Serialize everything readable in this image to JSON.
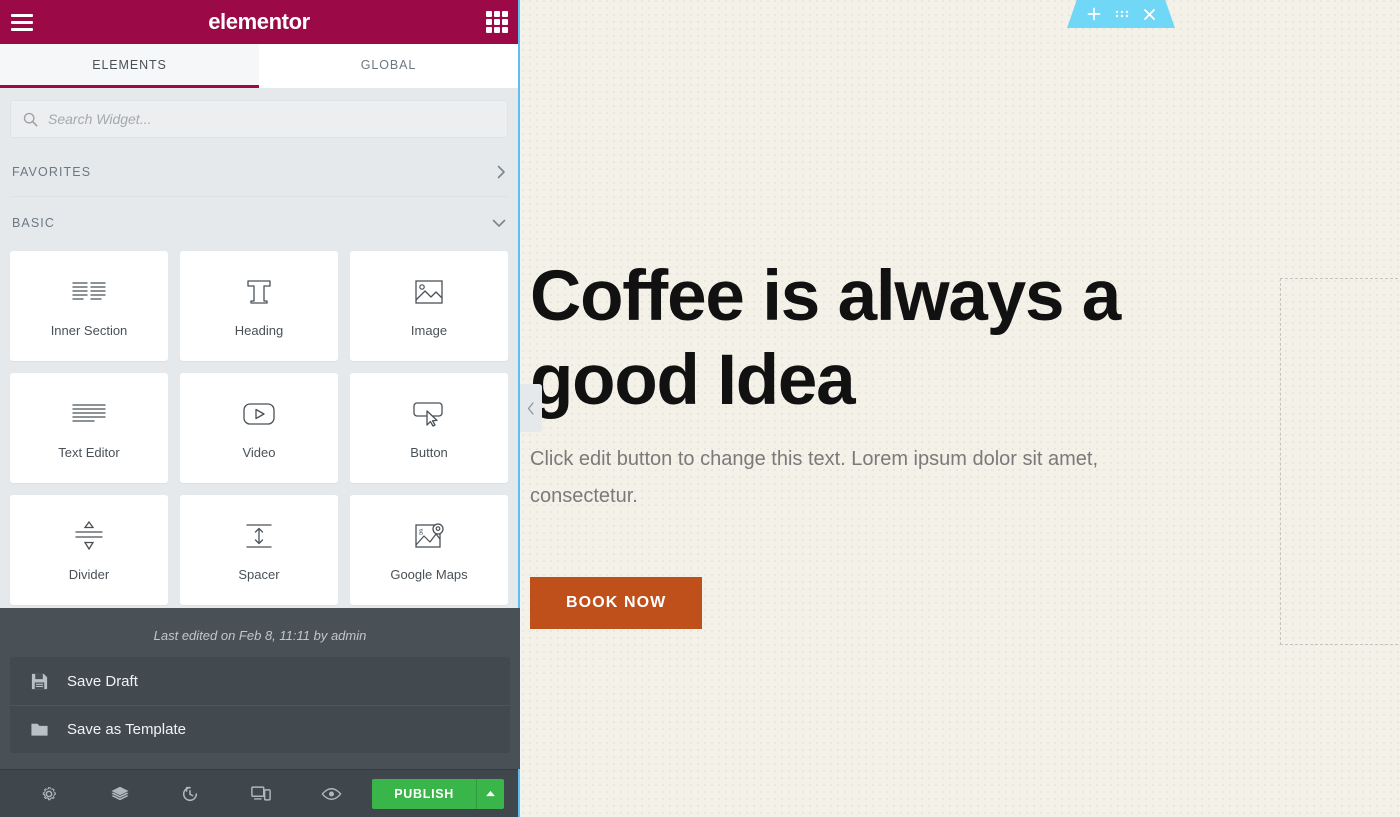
{
  "panel": {
    "brand": "elementor",
    "menu_icon": "hamburger-menu-icon",
    "apps_icon": "apps-grid-icon",
    "tabs": [
      {
        "label": "ELEMENTS",
        "active": true
      },
      {
        "label": "GLOBAL",
        "active": false
      }
    ],
    "search": {
      "placeholder": "Search Widget...",
      "value": "",
      "icon": "search-icon"
    },
    "categories": [
      {
        "label": "FAVORITES",
        "expanded": false,
        "chevron": "chevron-right-icon"
      },
      {
        "label": "BASIC",
        "expanded": true,
        "chevron": "chevron-down-icon"
      }
    ],
    "widgets": [
      {
        "label": "Inner Section",
        "icon": "columns-icon"
      },
      {
        "label": "Heading",
        "icon": "heading-t-icon"
      },
      {
        "label": "Image",
        "icon": "image-icon"
      },
      {
        "label": "Text Editor",
        "icon": "text-lines-icon"
      },
      {
        "label": "Video",
        "icon": "video-play-icon"
      },
      {
        "label": "Button",
        "icon": "button-cursor-icon"
      },
      {
        "label": "Divider",
        "icon": "divider-icon"
      },
      {
        "label": "Spacer",
        "icon": "spacer-icon"
      },
      {
        "label": "Google Maps",
        "icon": "map-pin-icon"
      }
    ],
    "save_flyout": {
      "last_edited": "Last edited on Feb 8, 11:11 by admin",
      "items": [
        {
          "label": "Save Draft",
          "icon": "floppy-disk-icon"
        },
        {
          "label": "Save as Template",
          "icon": "folder-icon"
        }
      ]
    },
    "footer": {
      "buttons": [
        {
          "name": "settings",
          "icon": "gear-icon"
        },
        {
          "name": "navigator",
          "icon": "layers-icon"
        },
        {
          "name": "history",
          "icon": "history-clock-icon"
        },
        {
          "name": "responsive-mode",
          "icon": "responsive-devices-icon"
        },
        {
          "name": "preview",
          "icon": "eye-icon"
        }
      ],
      "publish_label": "PUBLISH",
      "publish_caret_icon": "caret-up-icon"
    },
    "collapse_handle_icon": "chevron-left-icon"
  },
  "canvas": {
    "section_toolbar": [
      {
        "name": "add-section",
        "icon": "plus-icon"
      },
      {
        "name": "edit-section",
        "icon": "drag-dots-icon"
      },
      {
        "name": "remove-section",
        "icon": "close-x-icon"
      }
    ],
    "hero_title": "Coffee is always a good Idea",
    "hero_description": "Click edit button to change this text. Lorem ipsum dolor sit amet, consectetur.",
    "cta_label": "BOOK NOW"
  },
  "colors": {
    "brand_maroon": "#9b0a46",
    "accent_blue": "#5bc0f0",
    "toolbar_blue": "#71d7f7",
    "publish_green": "#39b54a",
    "cta_orange": "#bf501c",
    "panel_dark": "#495157",
    "panel_bg": "#e6e9ec",
    "canvas_bg": "#f4f1e8"
  }
}
